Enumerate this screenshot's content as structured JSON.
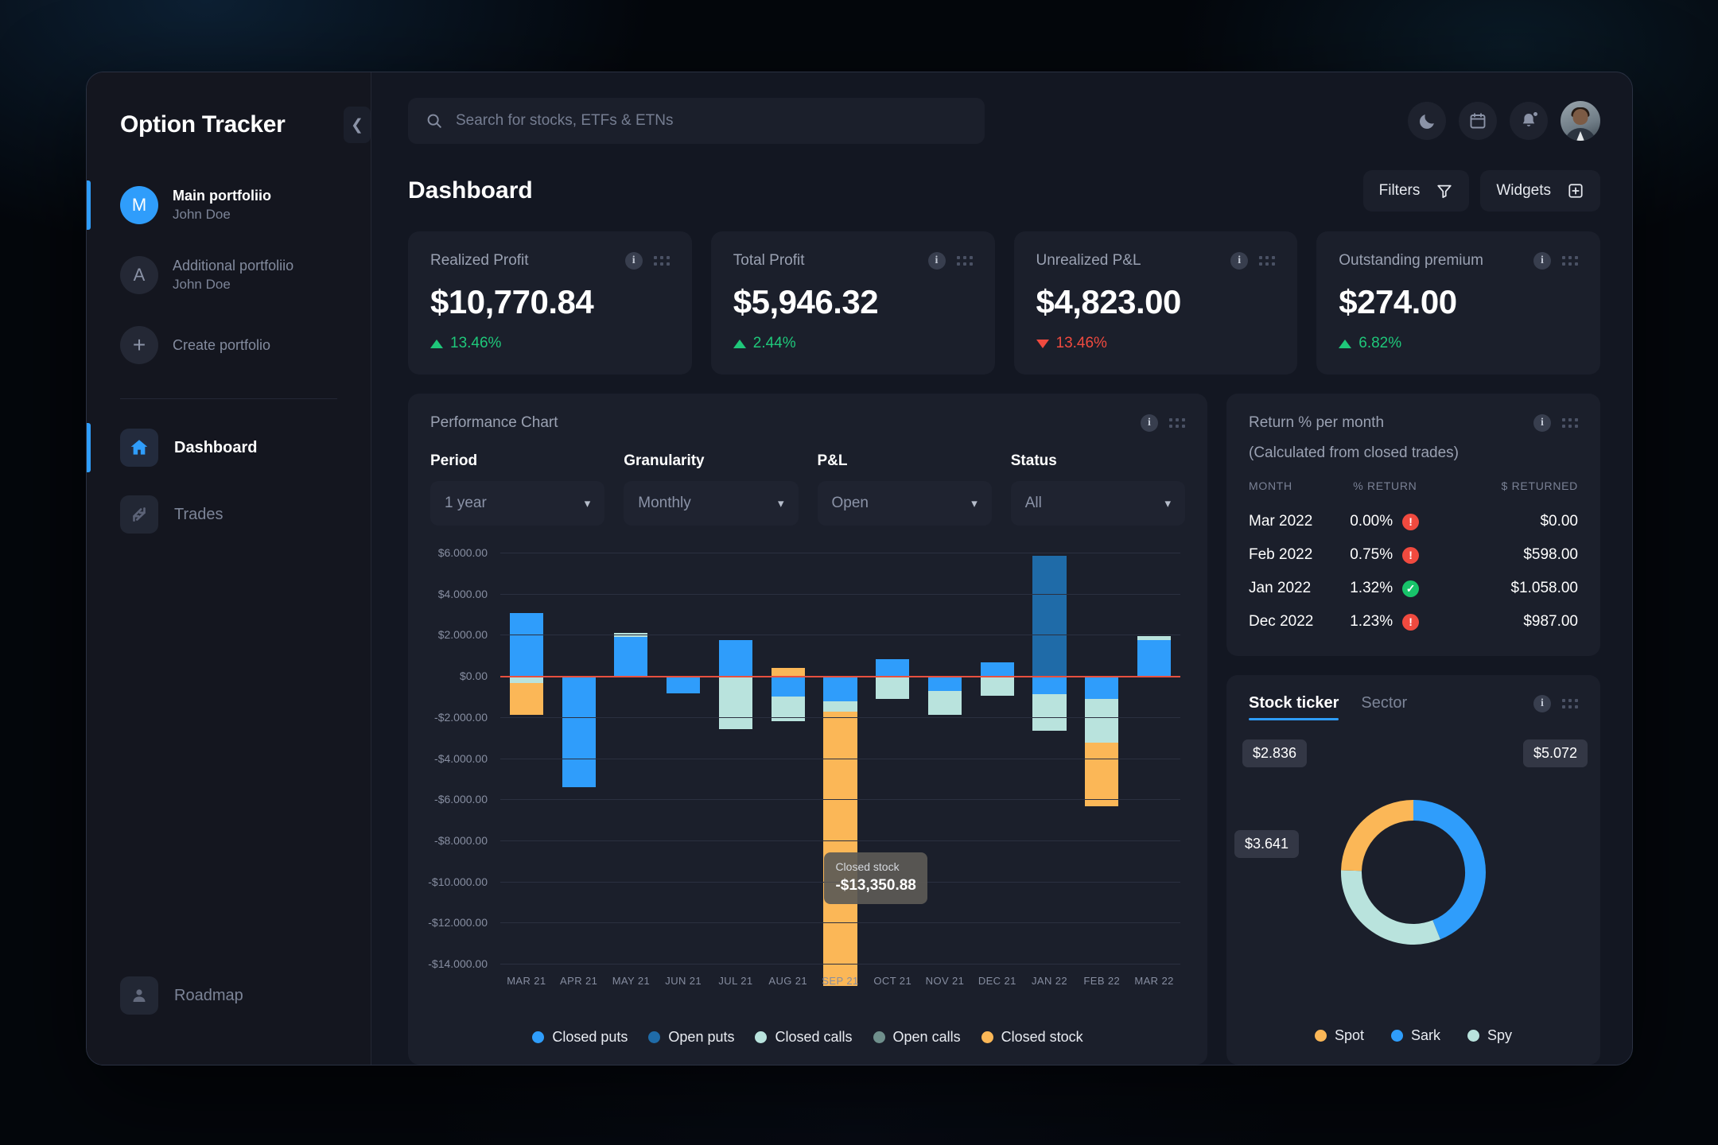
{
  "app": {
    "brand": "Option Tracker",
    "collapse_icon": "chevron-left"
  },
  "sidebar": {
    "portfolios": [
      {
        "initial": "M",
        "name": "Main portfoliio",
        "owner": "John Doe",
        "active": true
      },
      {
        "initial": "A",
        "name": "Additional portfoliio",
        "owner": "John Doe",
        "active": false
      }
    ],
    "create_portfolio": "Create portfolio",
    "nav": [
      {
        "label": "Dashboard",
        "icon": "home-icon",
        "active": true
      },
      {
        "label": "Trades",
        "icon": "trades-arrows-icon",
        "active": false
      }
    ],
    "roadmap": {
      "label": "Roadmap",
      "icon": "user-icon"
    }
  },
  "topbar": {
    "search_placeholder": "Search for stocks, ETFs & ETNs",
    "icons": [
      "moon-icon",
      "calendar-icon",
      "bell-icon"
    ],
    "avatar": "user-avatar"
  },
  "header": {
    "title": "Dashboard",
    "filters_label": "Filters",
    "widgets_label": "Widgets"
  },
  "kpis": [
    {
      "title": "Realized Profit",
      "value": "$10,770.84",
      "delta": "13.46%",
      "direction": "up"
    },
    {
      "title": "Total Profit",
      "value": "$5,946.32",
      "delta": "2.44%",
      "direction": "up"
    },
    {
      "title": "Unrealized P&L",
      "value": "$4,823.00",
      "delta": "13.46%",
      "direction": "down"
    },
    {
      "title": "Outstanding premium",
      "value": "$274.00",
      "delta": "6.82%",
      "direction": "up"
    }
  ],
  "performance": {
    "title": "Performance Chart",
    "filters": [
      {
        "label": "Period",
        "value": "1 year"
      },
      {
        "label": "Granularity",
        "value": "Monthly"
      },
      {
        "label": "P&L",
        "value": "Open"
      },
      {
        "label": "Status",
        "value": "All"
      }
    ],
    "tooltip": {
      "label": "Closed stock",
      "value": "-$13,350.88"
    }
  },
  "chart_data": {
    "type": "bar",
    "title": "Performance Chart",
    "stacked": true,
    "grid": true,
    "legend_position": "bottom",
    "xlabel": "",
    "ylabel": "",
    "ylim": [
      -14000,
      6000
    ],
    "ytick_step": 2000,
    "ytick_labels": [
      "$6.000.00",
      "$4.000.00",
      "$2.000.00",
      "$0.00",
      "-$2.000.00",
      "-$4.000.00",
      "-$6.000.00",
      "-$8.000.00",
      "-$10.000.00",
      "-$12.000.00",
      "-$14.000.00"
    ],
    "categories": [
      "MAR 21",
      "APR 21",
      "MAY 21",
      "JUN 21",
      "JUL 21",
      "AUG 21",
      "SEP 21",
      "OCT 21",
      "NOV 21",
      "DEC 21",
      "JAN 22",
      "FEB 22",
      "MAR 22"
    ],
    "series": [
      {
        "name": "Closed puts",
        "color": "#2f9dfb",
        "values": [
          3050,
          -5400,
          1900,
          -850,
          1750,
          -1000,
          -1250,
          800,
          -750,
          650,
          -900,
          -1100,
          1750
        ]
      },
      {
        "name": "Open puts",
        "color": "#1f6ba8",
        "values": [
          0,
          0,
          0,
          0,
          0,
          0,
          0,
          0,
          0,
          0,
          5850,
          0,
          0
        ]
      },
      {
        "name": "Closed calls",
        "color": "#b9e3dd",
        "values": [
          -360,
          0,
          200,
          0,
          -2600,
          -1200,
          -500,
          -1100,
          -1150,
          -950,
          -1750,
          -2150,
          200
        ]
      },
      {
        "name": "Open calls",
        "color": "#6f8f8c",
        "values": [
          0,
          0,
          0,
          0,
          0,
          0,
          0,
          0,
          0,
          0,
          0,
          0,
          0
        ]
      },
      {
        "name": "Closed stock",
        "color": "#fbb757",
        "values": [
          -1550,
          0,
          0,
          0,
          0,
          400,
          -13350.88,
          0,
          0,
          0,
          0,
          -3100,
          0
        ]
      }
    ]
  },
  "returns": {
    "title": "Return % per month",
    "subtitle": "(Calculated from closed trades)",
    "columns": [
      "MONTH",
      "% RETURN",
      "$ RETURNED"
    ],
    "rows": [
      {
        "month": "Mar 2022",
        "pct": "0.00%",
        "status": "warn",
        "amount": "$0.00"
      },
      {
        "month": "Feb 2022",
        "pct": "0.75%",
        "status": "warn",
        "amount": "$598.00"
      },
      {
        "month": "Jan 2022",
        "pct": "1.32%",
        "status": "ok",
        "amount": "$1.058.00"
      },
      {
        "month": "Dec 2022",
        "pct": "1.23%",
        "status": "warn",
        "amount": "$987.00"
      }
    ]
  },
  "ticker": {
    "tabs": [
      {
        "label": "Stock ticker",
        "active": true
      },
      {
        "label": "Sector",
        "active": false
      }
    ],
    "donut": {
      "type": "pie",
      "slices": [
        {
          "name": "Spot",
          "label": "$2.836",
          "value": 2836,
          "color": "#fbb757"
        },
        {
          "name": "Sark",
          "label": "$5.072",
          "value": 5072,
          "color": "#2f9dfb"
        },
        {
          "name": "Spy",
          "label": "$3.641",
          "value": 3641,
          "color": "#b9e3dd"
        }
      ]
    }
  },
  "colors": {
    "accent": "#2f9dfb",
    "positive": "#1fc77a",
    "negative": "#f04a3f",
    "panel": "#1b1f2b",
    "zero_line": "#e8503f"
  }
}
